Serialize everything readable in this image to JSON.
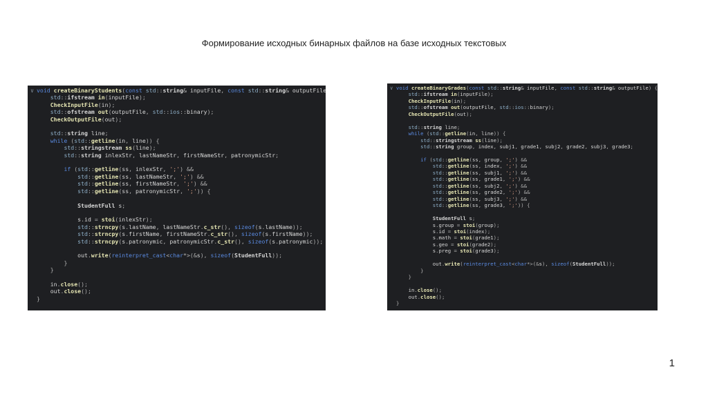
{
  "slide": {
    "title": "Формирование исходных бинарных файлов на базе исходных текстовых",
    "page_number": "1"
  },
  "colors": {
    "background": "#ffffff",
    "code_background": "#1e1f22",
    "keyword": "#5a8ae0",
    "function": "#e6e6b3",
    "string_literal": "#d69d85",
    "default_text": "#d7d7d7"
  },
  "code_left": {
    "language": "C++",
    "lines": [
      "void createBinaryStudents(const std::string& inputFile, const std::string& outputFile)",
      "    std::ifstream in(inputFile);",
      "    CheckInputFile(in);",
      "    std::ofstream out(outputFile, std::ios::binary);",
      "    CheckOutputFile(out);",
      "",
      "    std::string line;",
      "    while (std::getline(in, line)) {",
      "        std::stringstream ss(line);",
      "        std::string inlexStr, lastNameStr, firstNameStr, patronymicStr;",
      "",
      "        if (std::getline(ss, inlexStr, ';') &&",
      "            std::getline(ss, lastNameStr, ';') &&",
      "            std::getline(ss, firstNameStr, ';') &&",
      "            std::getline(ss, patronymicStr, ';')) {",
      "",
      "            StudentFull s;",
      "",
      "            s.id = stoi(inlexStr);",
      "            std::strncpy(s.lastName, lastNameStr.c_str(), sizeof(s.lastName));",
      "            std::strncpy(s.firstName, firstNameStr.c_str(), sizeof(s.firstName));",
      "            std::strncpy(s.patronymic, patronymicStr.c_str(), sizeof(s.patronymic));",
      "",
      "            out.write(reinterpret_cast<char*>(&s), sizeof(StudentFull));",
      "        }",
      "    }",
      "",
      "    in.close();",
      "    out.close();",
      "}"
    ]
  },
  "code_right": {
    "language": "C++",
    "lines": [
      "void createBinaryGrades(const std::string& inputFile, const std::string& outputFile) {",
      "    std::ifstream in(inputFile);",
      "    CheckInputFile(in);",
      "    std::ofstream out(outputFile, std::ios::binary);",
      "    CheckOutputFile(out);",
      "",
      "    std::string line;",
      "    while (std::getline(in, line)) {",
      "        std::stringstream ss(line);",
      "        std::string group, index, subj1, grade1, subj2, grade2, subj3, grade3;",
      "",
      "        if (std::getline(ss, group, ';') &&",
      "            std::getline(ss, index, ';') &&",
      "            std::getline(ss, subj1, ';') &&",
      "            std::getline(ss, grade1, ';') &&",
      "            std::getline(ss, subj2, ';') &&",
      "            std::getline(ss, grade2, ';') &&",
      "            std::getline(ss, subj3, ';') &&",
      "            std::getline(ss, grade3, ';')) {",
      "",
      "            StudentFull s;",
      "            s.group = stoi(group);",
      "            s.id = stoi(index);",
      "            s.math = stoi(grade1);",
      "            s.geo = stoi(grade2);",
      "            s.preg = stoi(grade3);",
      "",
      "            out.write(reinterpret_cast<char*>(&s), sizeof(StudentFull));",
      "        }",
      "    }",
      "",
      "    in.close();",
      "    out.close();",
      "}"
    ]
  }
}
